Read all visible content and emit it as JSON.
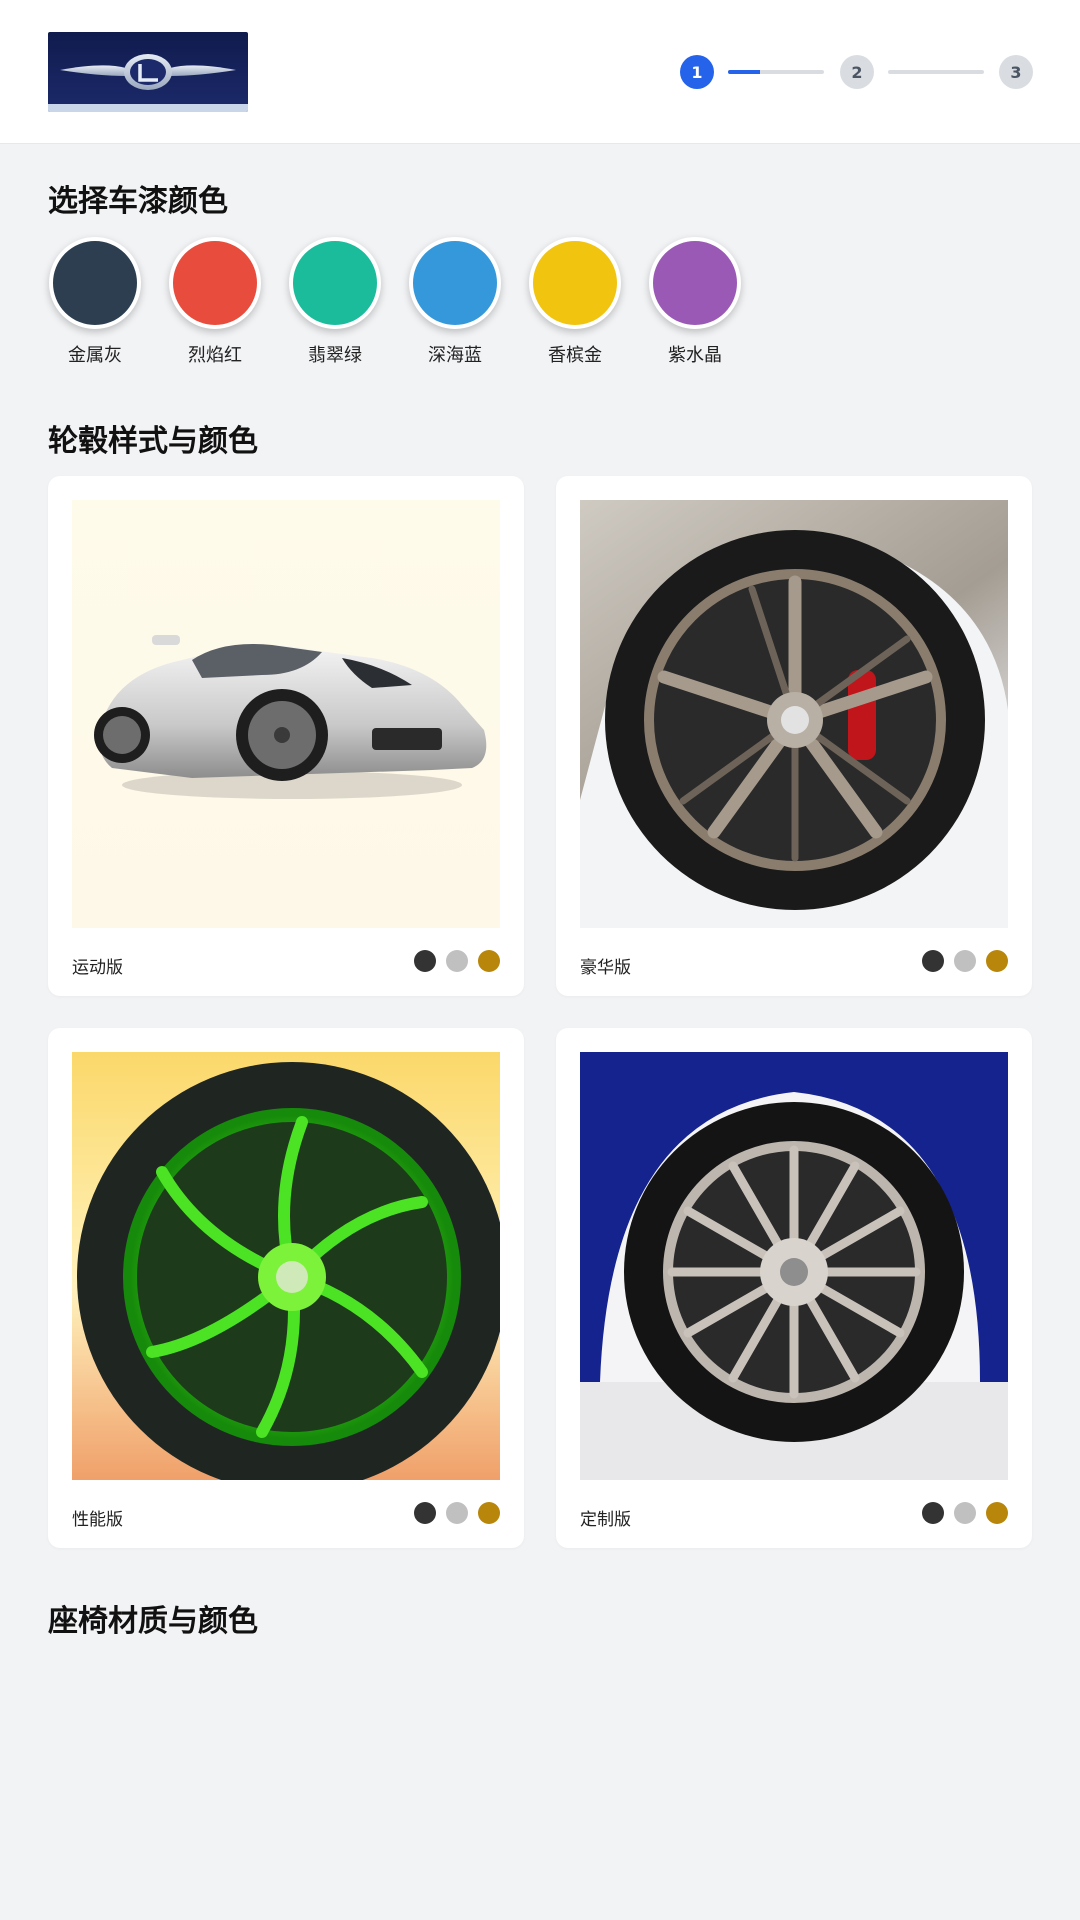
{
  "header": {
    "logo_icon": "brand-wing-logo",
    "steps": [
      {
        "label": "1",
        "state": "active"
      },
      {
        "label": "2",
        "state": "pending"
      },
      {
        "label": "3",
        "state": "pending"
      }
    ],
    "step1_progress": 0.33
  },
  "paint": {
    "title": "选择车漆颜色",
    "colors": [
      {
        "name": "金属灰",
        "hex": "#2c3e50"
      },
      {
        "name": "烈焰红",
        "hex": "#e74c3c"
      },
      {
        "name": "翡翠绿",
        "hex": "#1abc9c"
      },
      {
        "name": "深海蓝",
        "hex": "#3498db"
      },
      {
        "name": "香槟金",
        "hex": "#f1c40f"
      },
      {
        "name": "紫水晶",
        "hex": "#9b59b6"
      }
    ]
  },
  "wheels": {
    "title": "轮毂样式与颜色",
    "items": [
      {
        "name": "运动版",
        "image": "silver-sports-car"
      },
      {
        "name": "豪华版",
        "image": "bronze-wheel-red-caliper"
      },
      {
        "name": "性能版",
        "image": "green-wheel"
      },
      {
        "name": "定制版",
        "image": "silver-wheel-blue-car"
      }
    ],
    "finish_colors": [
      "#333333",
      "#c0c0c0",
      "#b8860b"
    ]
  },
  "seats": {
    "title": "座椅材质与颜色"
  }
}
